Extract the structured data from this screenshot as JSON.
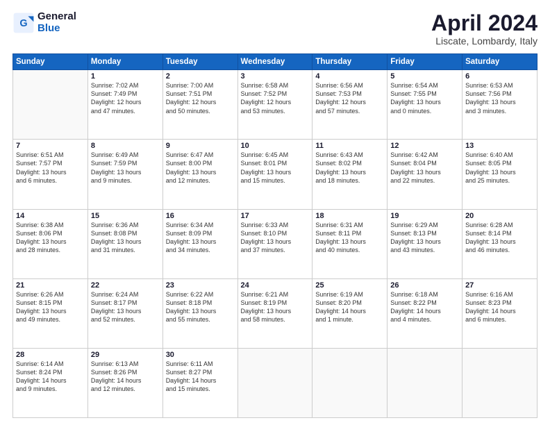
{
  "header": {
    "logo_general": "General",
    "logo_blue": "Blue",
    "title": "April 2024",
    "subtitle": "Liscate, Lombardy, Italy"
  },
  "columns": [
    "Sunday",
    "Monday",
    "Tuesday",
    "Wednesday",
    "Thursday",
    "Friday",
    "Saturday"
  ],
  "weeks": [
    [
      {
        "day": "",
        "info": ""
      },
      {
        "day": "1",
        "info": "Sunrise: 7:02 AM\nSunset: 7:49 PM\nDaylight: 12 hours\nand 47 minutes."
      },
      {
        "day": "2",
        "info": "Sunrise: 7:00 AM\nSunset: 7:51 PM\nDaylight: 12 hours\nand 50 minutes."
      },
      {
        "day": "3",
        "info": "Sunrise: 6:58 AM\nSunset: 7:52 PM\nDaylight: 12 hours\nand 53 minutes."
      },
      {
        "day": "4",
        "info": "Sunrise: 6:56 AM\nSunset: 7:53 PM\nDaylight: 12 hours\nand 57 minutes."
      },
      {
        "day": "5",
        "info": "Sunrise: 6:54 AM\nSunset: 7:55 PM\nDaylight: 13 hours\nand 0 minutes."
      },
      {
        "day": "6",
        "info": "Sunrise: 6:53 AM\nSunset: 7:56 PM\nDaylight: 13 hours\nand 3 minutes."
      }
    ],
    [
      {
        "day": "7",
        "info": "Sunrise: 6:51 AM\nSunset: 7:57 PM\nDaylight: 13 hours\nand 6 minutes."
      },
      {
        "day": "8",
        "info": "Sunrise: 6:49 AM\nSunset: 7:59 PM\nDaylight: 13 hours\nand 9 minutes."
      },
      {
        "day": "9",
        "info": "Sunrise: 6:47 AM\nSunset: 8:00 PM\nDaylight: 13 hours\nand 12 minutes."
      },
      {
        "day": "10",
        "info": "Sunrise: 6:45 AM\nSunset: 8:01 PM\nDaylight: 13 hours\nand 15 minutes."
      },
      {
        "day": "11",
        "info": "Sunrise: 6:43 AM\nSunset: 8:02 PM\nDaylight: 13 hours\nand 18 minutes."
      },
      {
        "day": "12",
        "info": "Sunrise: 6:42 AM\nSunset: 8:04 PM\nDaylight: 13 hours\nand 22 minutes."
      },
      {
        "day": "13",
        "info": "Sunrise: 6:40 AM\nSunset: 8:05 PM\nDaylight: 13 hours\nand 25 minutes."
      }
    ],
    [
      {
        "day": "14",
        "info": "Sunrise: 6:38 AM\nSunset: 8:06 PM\nDaylight: 13 hours\nand 28 minutes."
      },
      {
        "day": "15",
        "info": "Sunrise: 6:36 AM\nSunset: 8:08 PM\nDaylight: 13 hours\nand 31 minutes."
      },
      {
        "day": "16",
        "info": "Sunrise: 6:34 AM\nSunset: 8:09 PM\nDaylight: 13 hours\nand 34 minutes."
      },
      {
        "day": "17",
        "info": "Sunrise: 6:33 AM\nSunset: 8:10 PM\nDaylight: 13 hours\nand 37 minutes."
      },
      {
        "day": "18",
        "info": "Sunrise: 6:31 AM\nSunset: 8:11 PM\nDaylight: 13 hours\nand 40 minutes."
      },
      {
        "day": "19",
        "info": "Sunrise: 6:29 AM\nSunset: 8:13 PM\nDaylight: 13 hours\nand 43 minutes."
      },
      {
        "day": "20",
        "info": "Sunrise: 6:28 AM\nSunset: 8:14 PM\nDaylight: 13 hours\nand 46 minutes."
      }
    ],
    [
      {
        "day": "21",
        "info": "Sunrise: 6:26 AM\nSunset: 8:15 PM\nDaylight: 13 hours\nand 49 minutes."
      },
      {
        "day": "22",
        "info": "Sunrise: 6:24 AM\nSunset: 8:17 PM\nDaylight: 13 hours\nand 52 minutes."
      },
      {
        "day": "23",
        "info": "Sunrise: 6:22 AM\nSunset: 8:18 PM\nDaylight: 13 hours\nand 55 minutes."
      },
      {
        "day": "24",
        "info": "Sunrise: 6:21 AM\nSunset: 8:19 PM\nDaylight: 13 hours\nand 58 minutes."
      },
      {
        "day": "25",
        "info": "Sunrise: 6:19 AM\nSunset: 8:20 PM\nDaylight: 14 hours\nand 1 minute."
      },
      {
        "day": "26",
        "info": "Sunrise: 6:18 AM\nSunset: 8:22 PM\nDaylight: 14 hours\nand 4 minutes."
      },
      {
        "day": "27",
        "info": "Sunrise: 6:16 AM\nSunset: 8:23 PM\nDaylight: 14 hours\nand 6 minutes."
      }
    ],
    [
      {
        "day": "28",
        "info": "Sunrise: 6:14 AM\nSunset: 8:24 PM\nDaylight: 14 hours\nand 9 minutes."
      },
      {
        "day": "29",
        "info": "Sunrise: 6:13 AM\nSunset: 8:26 PM\nDaylight: 14 hours\nand 12 minutes."
      },
      {
        "day": "30",
        "info": "Sunrise: 6:11 AM\nSunset: 8:27 PM\nDaylight: 14 hours\nand 15 minutes."
      },
      {
        "day": "",
        "info": ""
      },
      {
        "day": "",
        "info": ""
      },
      {
        "day": "",
        "info": ""
      },
      {
        "day": "",
        "info": ""
      }
    ]
  ]
}
